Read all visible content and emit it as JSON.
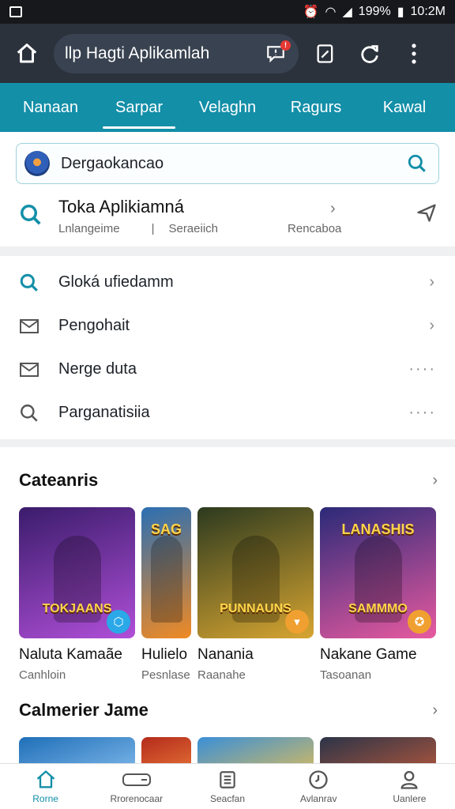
{
  "status_bar": {
    "battery": "199%",
    "time": "10:2M"
  },
  "app_bar": {
    "title": "llp Hagti Aplikamlah",
    "badge": "!"
  },
  "tabs": [
    "Nanaan",
    "Sarpar",
    "Velaghn",
    "Ragurs",
    "Kawal"
  ],
  "search": {
    "value": "Dergaokancao"
  },
  "store_row": {
    "name": "Toka Aplikiamná",
    "meta1": "Lnlangeime",
    "separator": "|",
    "meta2": "Seraeiich",
    "meta3": "Rencaboa"
  },
  "menu": [
    {
      "label": "Gloká ufiedamm",
      "icon": "search-icon",
      "trail": "›"
    },
    {
      "label": "Pengohait",
      "icon": "mail-icon",
      "trail": "›"
    },
    {
      "label": "Nerge duta",
      "icon": "mail-icon",
      "trail": "····"
    },
    {
      "label": "Parganatisiia",
      "icon": "search-outline-icon",
      "trail": "····"
    }
  ],
  "section1": {
    "title": "Cateanris",
    "cards": [
      {
        "name": "Naluta Kamaãe",
        "sub": "Canhloin",
        "art_text": "TOKJAANS",
        "art_top": "",
        "colors": [
          "#3a1c6b",
          "#b04fd8"
        ],
        "corner": "#2aa8e8"
      },
      {
        "name": "Hulielo",
        "sub": "Pesnlase",
        "art_text": "",
        "art_top": "SAG",
        "colors": [
          "#2b6fb3",
          "#f08a24"
        ],
        "corner": ""
      },
      {
        "name": "Nanania",
        "sub": "Raanahe",
        "art_text": "PUNNAUNS",
        "art_top": "",
        "colors": [
          "#2c3a1f",
          "#d7a531"
        ],
        "corner": "#f0a030"
      },
      {
        "name": "Nakane Game",
        "sub": "Tasoanan",
        "art_text": "SAMMMO",
        "art_top": "LANASHIS",
        "colors": [
          "#2b2a78",
          "#e85aa0"
        ],
        "corner": "#f0a030"
      }
    ]
  },
  "section2": {
    "title": "Calmerier Jame",
    "cards": [
      {
        "colors": [
          "#1f6fb8",
          "#8ac0f0"
        ]
      },
      {
        "colors": [
          "#b32b1c",
          "#f0803a"
        ]
      },
      {
        "colors": [
          "#3a8fd8",
          "#e8c050"
        ]
      },
      {
        "colors": [
          "#2b3448",
          "#c05a3a"
        ]
      }
    ]
  },
  "bottom_nav": [
    {
      "label": "Rorne",
      "icon": "home-icon"
    },
    {
      "label": "Rrorenocaar",
      "icon": "games-icon"
    },
    {
      "label": "Seacfan",
      "icon": "list-icon"
    },
    {
      "label": "Avlanrav",
      "icon": "clock-icon"
    },
    {
      "label": "Uanlere",
      "icon": "profile-icon"
    }
  ],
  "colors": {
    "accent": "#138fa8",
    "app_bar": "#2b323c"
  }
}
